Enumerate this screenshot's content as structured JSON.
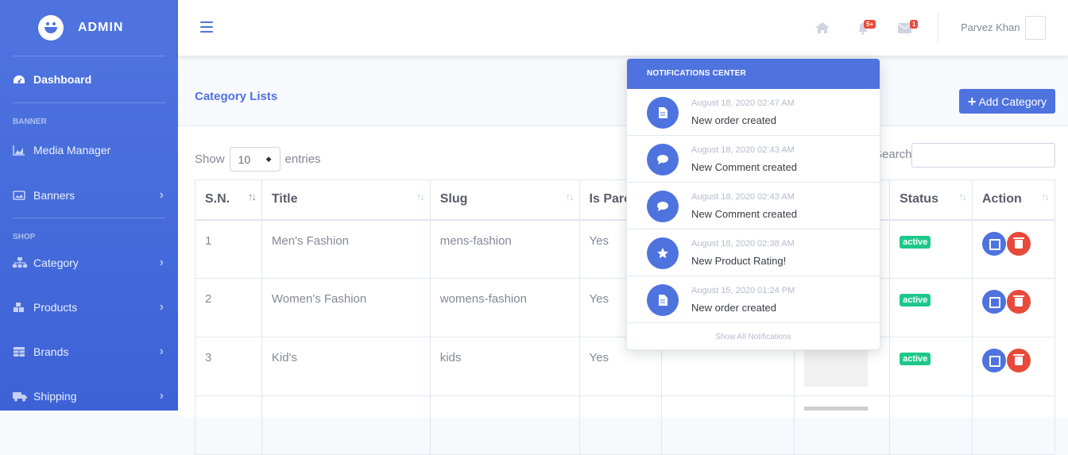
{
  "brand": {
    "name": "ADMIN"
  },
  "sidebar": {
    "dashboard": "Dashboard",
    "banner_heading": "BANNER",
    "media_manager": "Media Manager",
    "banners": "Banners",
    "shop_heading": "SHOP",
    "category": "Category",
    "products": "Products",
    "brands": "Brands",
    "shipping": "Shipping"
  },
  "topbar": {
    "alerts_badge": "5+",
    "messages_badge": "1",
    "user_name": "Parvez Khan"
  },
  "page": {
    "title": "Category Lists",
    "add_button": "Add Category",
    "show_label": "Show",
    "entries_value": "10",
    "entries_label": "entries",
    "search_label": "Search:",
    "search_value": ""
  },
  "table": {
    "headers": [
      "S.N.",
      "Title",
      "Slug",
      "Is Parent",
      "Status",
      "Action"
    ],
    "rows": [
      {
        "sn": "1",
        "title": "Men's Fashion",
        "slug": "mens-fashion",
        "parent": "Yes",
        "status": "active"
      },
      {
        "sn": "2",
        "title": "Women's Fashion",
        "slug": "womens-fashion",
        "parent": "Yes",
        "status": "active"
      },
      {
        "sn": "3",
        "title": "Kid's",
        "slug": "kids",
        "parent": "Yes",
        "status": "active"
      }
    ]
  },
  "notifications": {
    "header": "NOTIFICATIONS CENTER",
    "items": [
      {
        "icon": "file-icon",
        "date": "August 18, 2020 02:47 AM",
        "text": "New order created"
      },
      {
        "icon": "comment-icon",
        "date": "August 18, 2020 02:43 AM",
        "text": "New Comment created"
      },
      {
        "icon": "comment-icon",
        "date": "August 18, 2020 02:43 AM",
        "text": "New Comment created"
      },
      {
        "icon": "star-icon",
        "date": "August 18, 2020 02:38 AM",
        "text": "New Product Rating!"
      },
      {
        "icon": "file-icon",
        "date": "August 15, 2020 01:24 PM",
        "text": "New order created"
      }
    ],
    "footer": "Show All Notifications"
  },
  "colors": {
    "primary": "#4e73df",
    "danger": "#e74a3b",
    "success": "#1cc88a"
  }
}
